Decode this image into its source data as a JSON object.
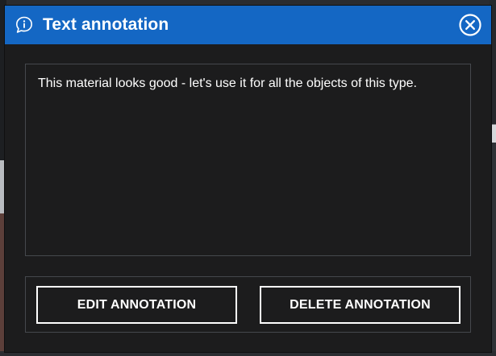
{
  "dialog": {
    "title": "Text annotation",
    "title_icon": "speech-bubble-info-icon",
    "close_icon": "close-circle-icon",
    "annotation_text": "This material looks good - let's use it for all the objects of this type.",
    "buttons": {
      "edit_label": "EDIT ANNOTATION",
      "delete_label": "DELETE ANNOTATION"
    }
  },
  "colors": {
    "titlebar": "#1467c4",
    "panel": "#1c1c1d",
    "border": "#45484d",
    "text": "#ffffff"
  }
}
